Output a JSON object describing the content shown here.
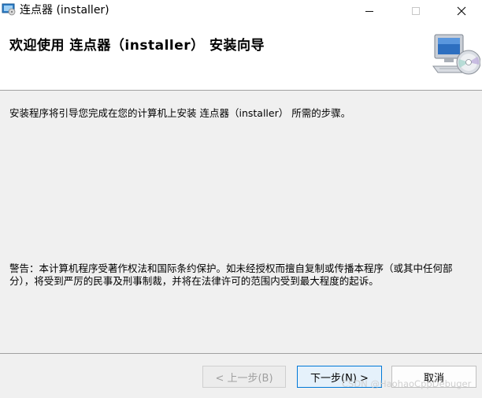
{
  "window": {
    "title": "连点器 (installer)"
  },
  "banner": {
    "title": "欢迎使用 连点器（installer） 安装向导",
    "icon": "computer-cd-icon"
  },
  "body": {
    "description": "安装程序将引导您完成在您的计算机上安装 连点器（installer） 所需的步骤。",
    "warning": "警告：本计算机程序受著作权法和国际条约保护。如未经授权而擅自复制或传播本程序（或其中任何部分），将受到严厉的民事及刑事制裁，并将在法律许可的范围内受到最大程度的起诉。"
  },
  "buttons": {
    "back": "< 上一步(B)",
    "next": "下一步(N) >",
    "cancel": "取消"
  },
  "watermark": "CSDN @HaohaoCppDebuger"
}
